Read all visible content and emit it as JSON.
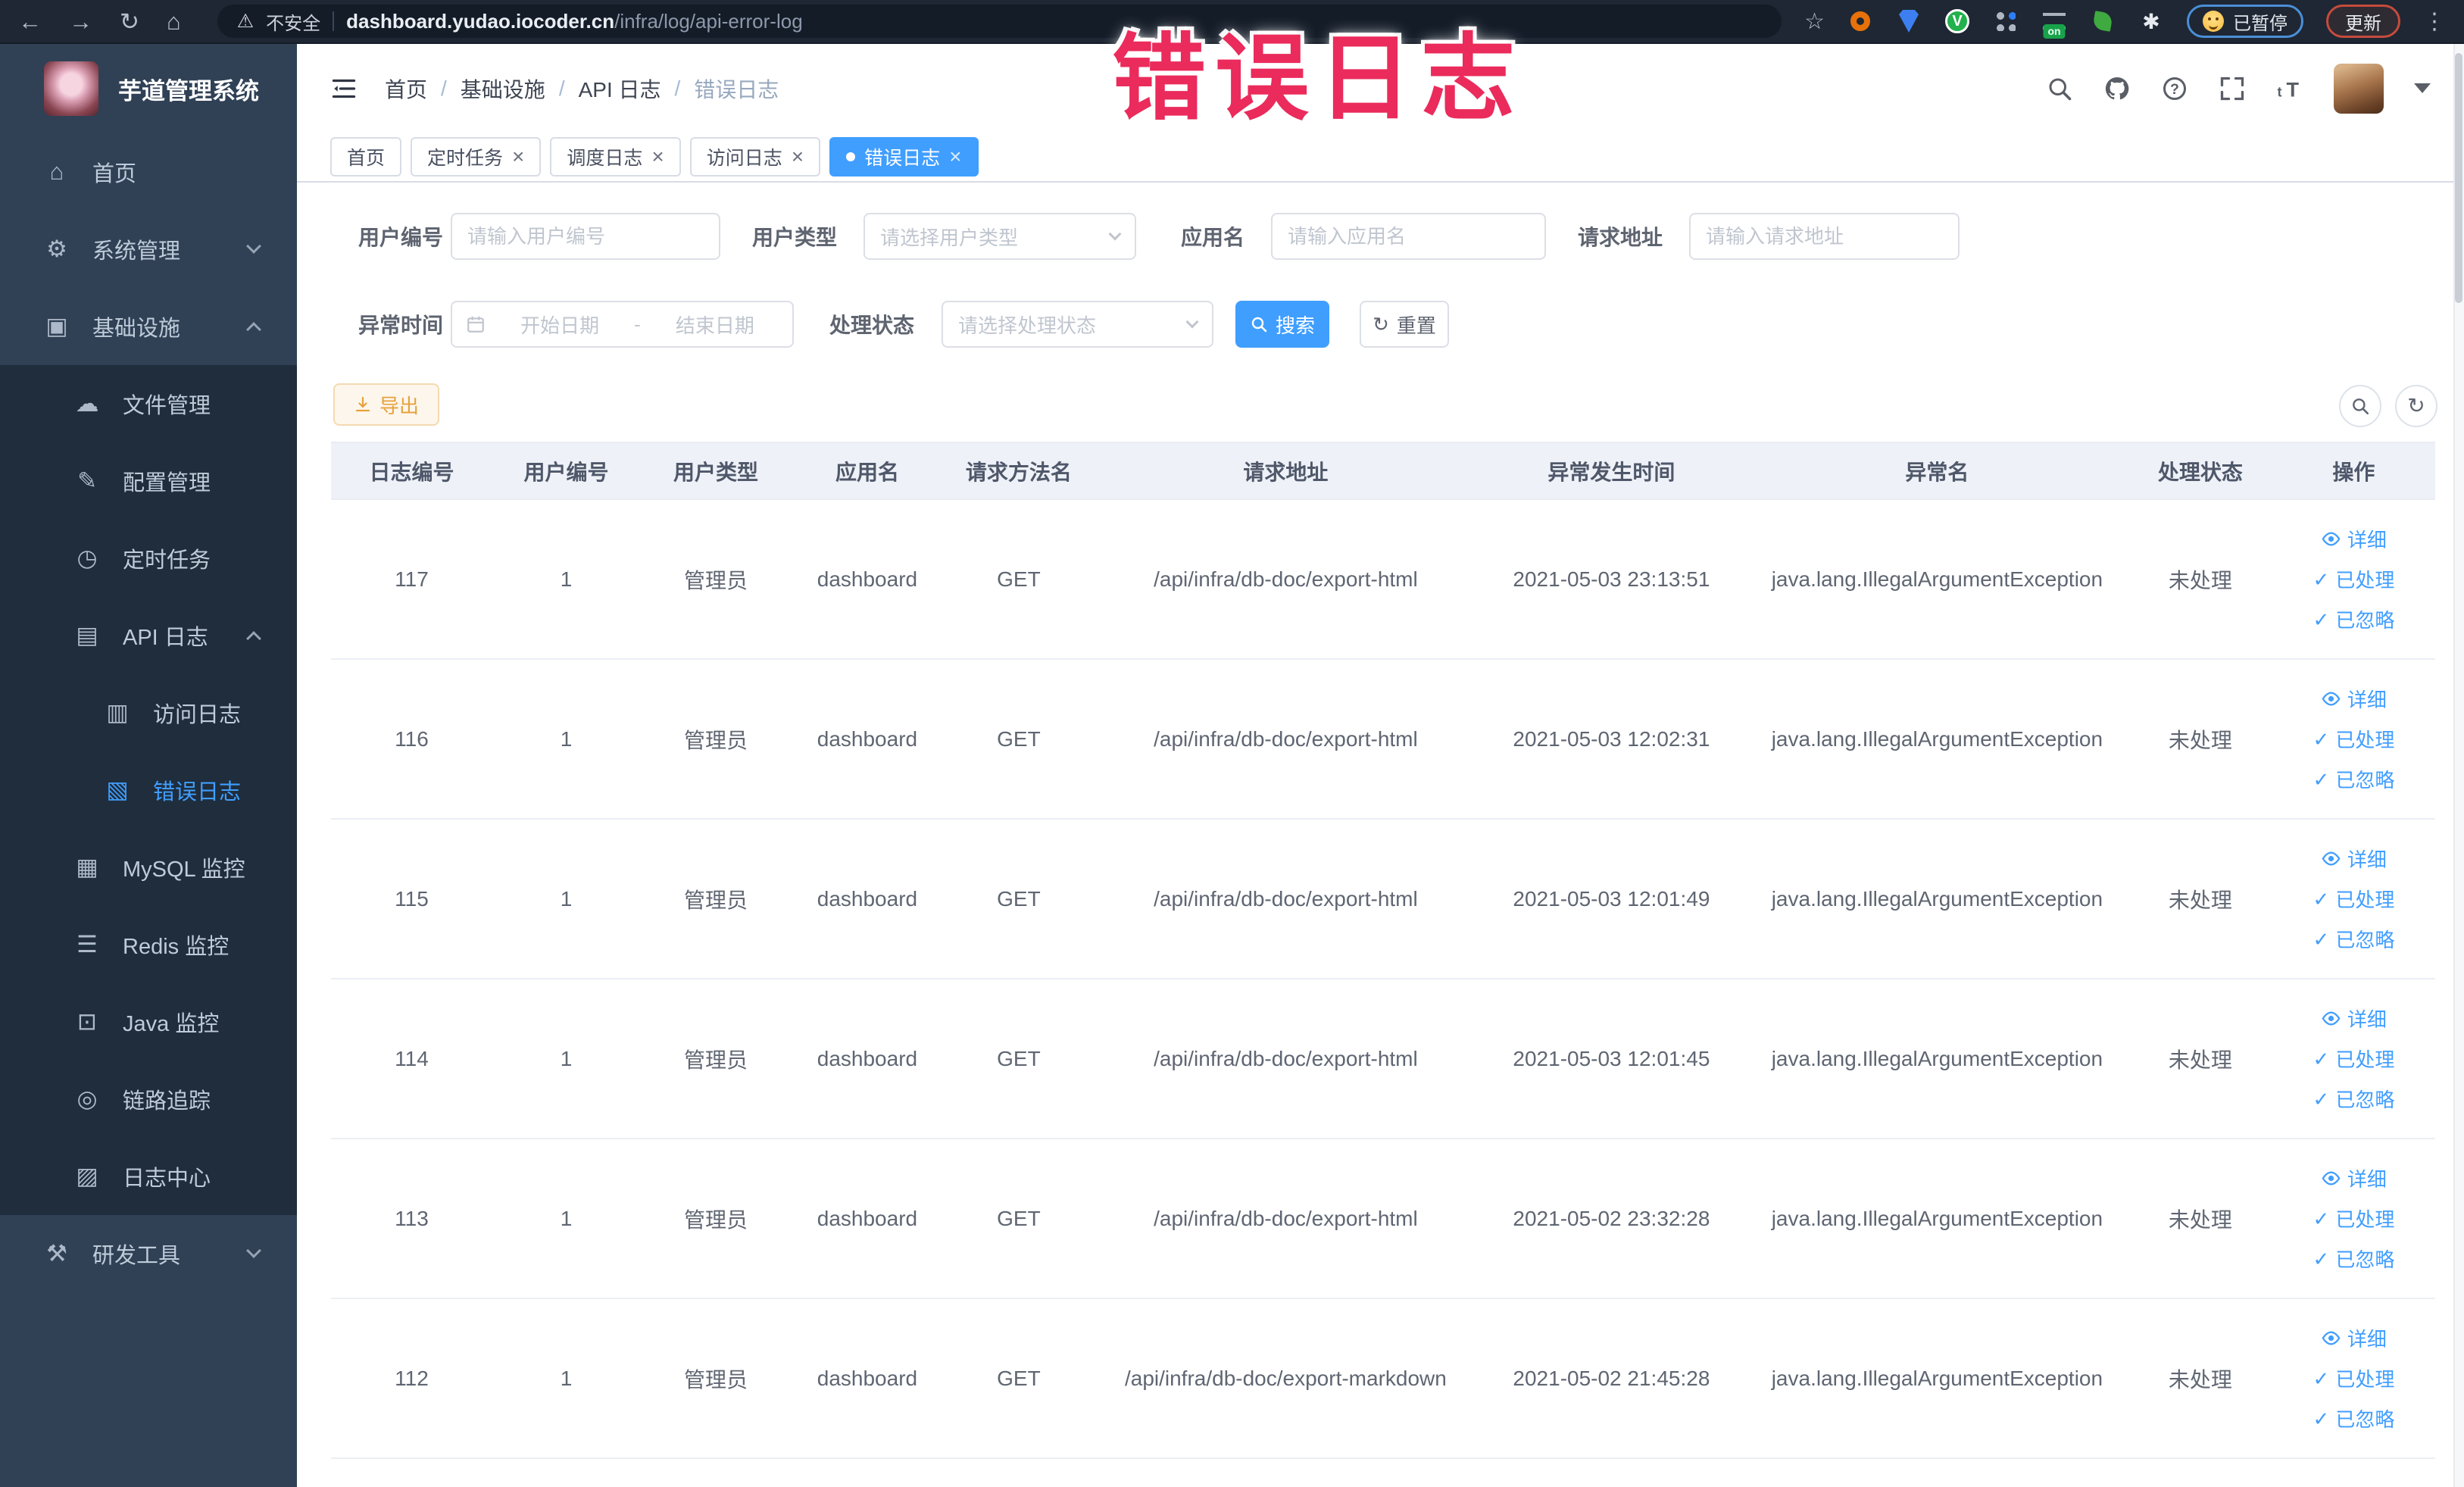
{
  "annotation": {
    "text": "错误日志"
  },
  "browser": {
    "security_label": "不安全",
    "url_host": "dashboard.yudao.iocoder.cn",
    "url_path": "/infra/log/api-error-log",
    "extensions_badge": "on",
    "paused_label": "已暂停",
    "update_label": "更新"
  },
  "sidebar": {
    "title": "芋道管理系统",
    "top": [
      {
        "label": "首页",
        "icon": "home"
      },
      {
        "label": "系统管理",
        "icon": "gear",
        "chevron": "down"
      },
      {
        "label": "基础设施",
        "icon": "infra",
        "chevron": "up"
      }
    ],
    "sub": [
      {
        "label": "文件管理",
        "icon": "file"
      },
      {
        "label": "配置管理",
        "icon": "config"
      },
      {
        "label": "定时任务",
        "icon": "cron"
      },
      {
        "label": "API 日志",
        "icon": "api",
        "chevron": "up"
      },
      {
        "label": "访问日志",
        "icon": "access",
        "level": 3
      },
      {
        "label": "错误日志",
        "icon": "error",
        "level": 3,
        "active": true
      },
      {
        "label": "MySQL 监控",
        "icon": "mysql"
      },
      {
        "label": "Redis 监控",
        "icon": "redis"
      },
      {
        "label": "Java 监控",
        "icon": "java"
      },
      {
        "label": "链路追踪",
        "icon": "trace"
      },
      {
        "label": "日志中心",
        "icon": "logcenter"
      }
    ],
    "bottom": [
      {
        "label": "研发工具",
        "icon": "tools",
        "chevron": "down"
      }
    ]
  },
  "header": {
    "breadcrumb": [
      "首页",
      "基础设施",
      "API 日志",
      "错误日志"
    ],
    "separator": "/"
  },
  "tabs": [
    {
      "label": "首页",
      "closable": false,
      "active": false
    },
    {
      "label": "定时任务",
      "closable": true,
      "active": false
    },
    {
      "label": "调度日志",
      "closable": true,
      "active": false
    },
    {
      "label": "访问日志",
      "closable": true,
      "active": false
    },
    {
      "label": "错误日志",
      "closable": true,
      "active": true
    }
  ],
  "filters": {
    "user_id": {
      "label": "用户编号",
      "placeholder": "请输入用户编号"
    },
    "user_type": {
      "label": "用户类型",
      "placeholder": "请选择用户类型"
    },
    "app_name": {
      "label": "应用名",
      "placeholder": "请输入应用名"
    },
    "request_url": {
      "label": "请求地址",
      "placeholder": "请输入请求地址"
    },
    "exception_time": {
      "label": "异常时间",
      "start_placeholder": "开始日期",
      "separator": "-",
      "end_placeholder": "结束日期"
    },
    "process_status": {
      "label": "处理状态",
      "placeholder": "请选择处理状态"
    },
    "search_label": "搜索",
    "reset_label": "重置"
  },
  "toolbar": {
    "export_label": "导出"
  },
  "table": {
    "columns": [
      "日志编号",
      "用户编号",
      "用户类型",
      "应用名",
      "请求方法名",
      "请求地址",
      "异常发生时间",
      "异常名",
      "处理状态",
      "操作"
    ],
    "op_labels": {
      "detail": "详细",
      "processed": "已处理",
      "ignored": "已忽略"
    },
    "rows": [
      {
        "id": "117",
        "user_id": "1",
        "user_type": "管理员",
        "app": "dashboard",
        "method": "GET",
        "url": "/api/infra/db-doc/export-html",
        "time": "2021-05-03 23:13:51",
        "exception": "java.lang.IllegalArgumentException",
        "status": "未处理"
      },
      {
        "id": "116",
        "user_id": "1",
        "user_type": "管理员",
        "app": "dashboard",
        "method": "GET",
        "url": "/api/infra/db-doc/export-html",
        "time": "2021-05-03 12:02:31",
        "exception": "java.lang.IllegalArgumentException",
        "status": "未处理"
      },
      {
        "id": "115",
        "user_id": "1",
        "user_type": "管理员",
        "app": "dashboard",
        "method": "GET",
        "url": "/api/infra/db-doc/export-html",
        "time": "2021-05-03 12:01:49",
        "exception": "java.lang.IllegalArgumentException",
        "status": "未处理"
      },
      {
        "id": "114",
        "user_id": "1",
        "user_type": "管理员",
        "app": "dashboard",
        "method": "GET",
        "url": "/api/infra/db-doc/export-html",
        "time": "2021-05-03 12:01:45",
        "exception": "java.lang.IllegalArgumentException",
        "status": "未处理"
      },
      {
        "id": "113",
        "user_id": "1",
        "user_type": "管理员",
        "app": "dashboard",
        "method": "GET",
        "url": "/api/infra/db-doc/export-html",
        "time": "2021-05-02 23:32:28",
        "exception": "java.lang.IllegalArgumentException",
        "status": "未处理"
      },
      {
        "id": "112",
        "user_id": "1",
        "user_type": "管理员",
        "app": "dashboard",
        "method": "GET",
        "url": "/api/infra/db-doc/export-markdown",
        "time": "2021-05-02 21:45:28",
        "exception": "java.lang.IllegalArgumentException",
        "status": "未处理"
      }
    ]
  },
  "colors": {
    "accent": "#409eff",
    "annotation": "#ea2b5b",
    "warning": "#e6a23c",
    "sidebar_bg": "#304156",
    "submenu_bg": "#1f2d3d"
  }
}
